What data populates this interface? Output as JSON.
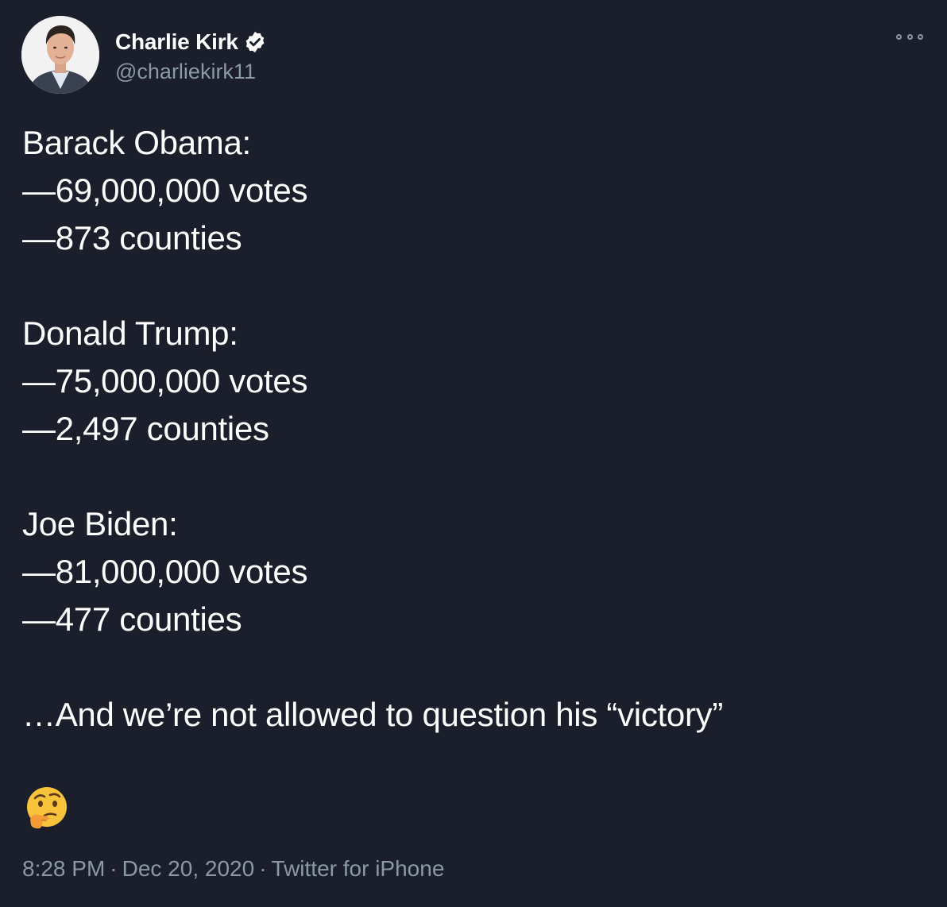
{
  "author": {
    "display_name": "Charlie Kirk",
    "handle": "@charliekirk11",
    "verified": true,
    "avatar_icon": "profile-photo"
  },
  "tweet": {
    "lines": [
      "Barack Obama:",
      "—69,000,000 votes",
      "—873 counties",
      "",
      "Donald Trump:",
      "—75,000,000 votes",
      "—2,497 counties",
      "",
      "Joe Biden:",
      "—81,000,000 votes",
      "—477 counties",
      "",
      "…And we’re not allowed to question his “victory”"
    ],
    "emoji": "thinking-face-emoji"
  },
  "meta": {
    "time": "8:28 PM",
    "separator": "·",
    "date": "Dec 20, 2020",
    "source": "Twitter for iPhone"
  },
  "menu": {
    "more_icon": "more-options-icon"
  },
  "colors": {
    "background": "#1a1f2b",
    "text": "#ffffff",
    "muted": "#8b98a5"
  }
}
